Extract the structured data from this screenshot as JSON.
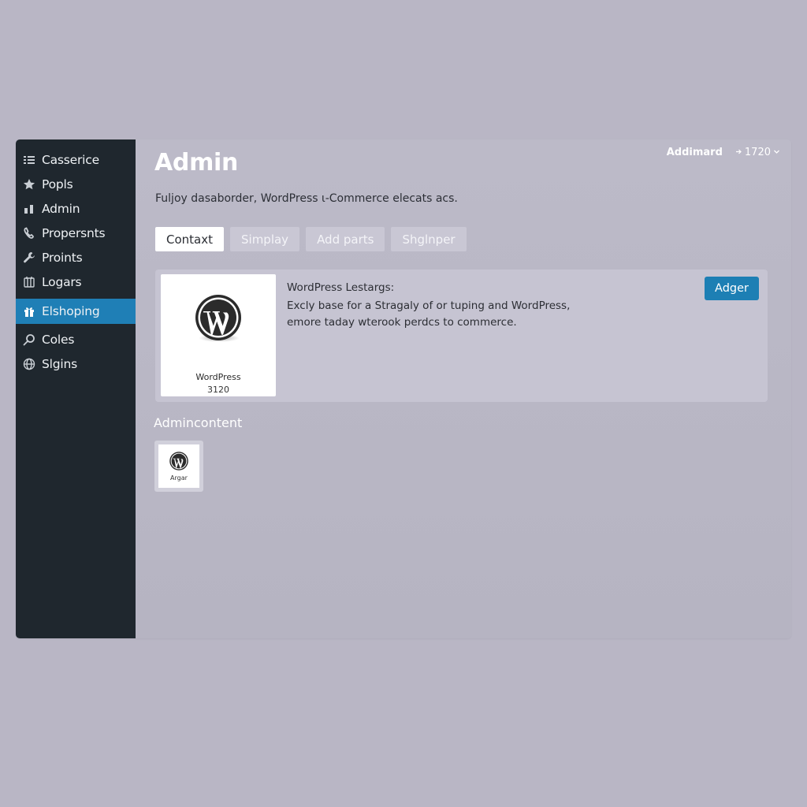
{
  "sidebar": {
    "items": [
      {
        "label": "Casserice",
        "icon": "list-icon"
      },
      {
        "label": "Popls",
        "icon": "star-icon"
      },
      {
        "label": "Admin",
        "icon": "bar-chart-icon"
      },
      {
        "label": "Propersnts",
        "icon": "phone-icon"
      },
      {
        "label": "Proints",
        "icon": "wrench-icon"
      },
      {
        "label": "Logars",
        "icon": "calendar-icon"
      },
      {
        "label": "Elshoping",
        "icon": "gift-icon",
        "active": true
      },
      {
        "label": "Coles",
        "icon": "search-icon"
      },
      {
        "label": "Slgins",
        "icon": "globe-icon"
      }
    ],
    "active_color": "#1f7fb6"
  },
  "header": {
    "title": "Admin",
    "user": "Addimard",
    "counter": "1720"
  },
  "subtitle": "Fuljoy dasaborder, WordPress ι-Commerce elecats acs.",
  "tabs": [
    {
      "label": "Contaxt",
      "active": true
    },
    {
      "label": "Simplay"
    },
    {
      "label": "Add parts"
    },
    {
      "label": "Shglnper"
    }
  ],
  "card": {
    "thumb_name": "WordPress",
    "thumb_number": "3120",
    "title": "WordPress Lestargs:",
    "description_line1": "Excly base for a Stragaly of or tuping and WordPress,",
    "description_line2": "emore taday wterook perdcs to commerce.",
    "button_label": "Adger",
    "button_color": "#1d7fb4"
  },
  "section": {
    "title": "Admincontent",
    "mini_label": "Argar"
  }
}
